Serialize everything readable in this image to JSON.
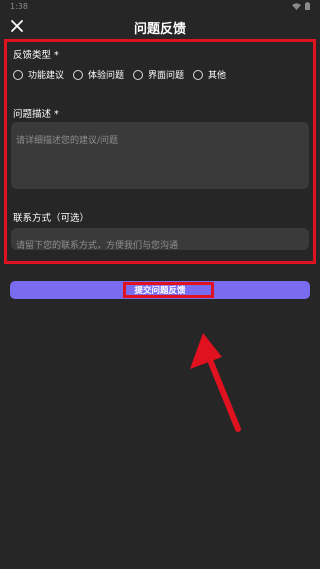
{
  "status_bar": {
    "time": "1:38"
  },
  "header": {
    "title": "问题反馈",
    "close_icon": "close-icon"
  },
  "form": {
    "feedback_type": {
      "label": "反馈类型",
      "required_mark": "*",
      "options": [
        "功能建议",
        "体验问题",
        "界面问题",
        "其他"
      ]
    },
    "description": {
      "label": "问题描述",
      "required_mark": "*",
      "placeholder": "请详细描述您的建议/问题"
    },
    "contact": {
      "label": "联系方式（可选）",
      "placeholder": "请留下您的联系方式，方便我们与您沟通"
    }
  },
  "submit": {
    "label": "提交问题反馈"
  },
  "colors": {
    "background": "#262626",
    "input_background": "#3a3a3a",
    "accent": "#7a6cf0",
    "annotation_red": "#e1121f"
  }
}
